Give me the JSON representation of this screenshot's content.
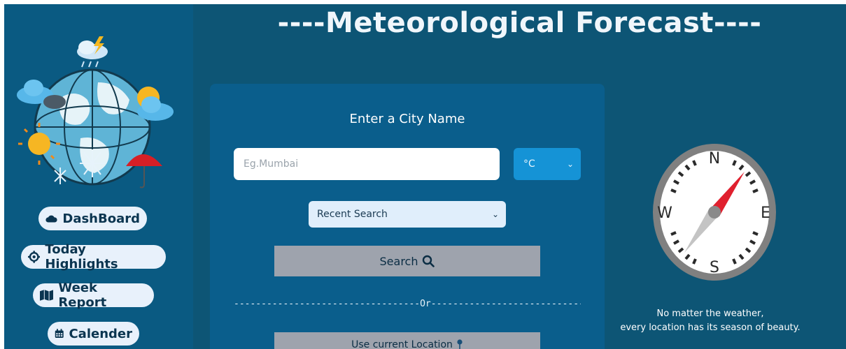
{
  "app": {
    "title": "----Meteorological Forecast----"
  },
  "sidebar": {
    "logo_icon": "weather-globe-icon",
    "items": [
      {
        "label": "DashBoard",
        "icon": "cloud-icon"
      },
      {
        "label": "Today Highlights",
        "icon": "crosshair-icon"
      },
      {
        "label": "Week Report",
        "icon": "map-icon"
      },
      {
        "label": "Calender",
        "icon": "calendar-icon"
      }
    ]
  },
  "search": {
    "heading": "Enter a City Name",
    "placeholder": "Eg.Mumbai",
    "value": "",
    "unit_selected": "°C",
    "recent_selected": "Recent Search",
    "search_label": "Search",
    "search_icon": "magnifier-icon",
    "divider_text": "----------------------------------Or-----------------------------------------",
    "location_label": "Use current Location",
    "location_icon": "pin-icon"
  },
  "compass": {
    "icon": "compass-icon",
    "n": "N",
    "s": "S",
    "e": "E",
    "w": "W"
  },
  "quote": {
    "line1": "No matter the weather,",
    "line2": "every location has its season of beauty."
  },
  "colors": {
    "background": "#0d5575",
    "sidebar": "#0a5a82",
    "card": "#0a5e8c",
    "unit_select": "#1593d6",
    "button_gray": "#9ea3ad",
    "compass_needle": "#e0202e"
  }
}
